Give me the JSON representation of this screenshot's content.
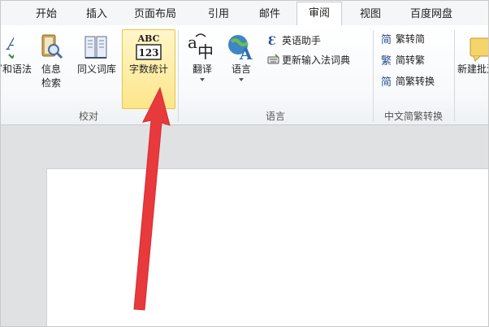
{
  "tabs": [
    {
      "label": "开始",
      "active": false
    },
    {
      "label": "插入",
      "active": false
    },
    {
      "label": "页面布局",
      "active": false
    },
    {
      "label": "引用",
      "active": false
    },
    {
      "label": "邮件",
      "active": false
    },
    {
      "label": "审阅",
      "active": true
    },
    {
      "label": "视图",
      "active": false
    },
    {
      "label": "百度网盘",
      "active": false
    }
  ],
  "ribbon": {
    "proofing": {
      "group_label": "校对",
      "grammar_label": "拼写和语法",
      "research_label_line1": "信息",
      "research_label_line2": "检索",
      "thesaurus_label": "同义词库",
      "word_count_label": "字数统计",
      "word_count_icon_text_top": "ABC",
      "word_count_icon_text_bottom": "123"
    },
    "language": {
      "group_label": "语言",
      "translate_label": "翻译",
      "language_label": "语言",
      "english_assistant_label": "英语助手",
      "update_ime_label": "更新输入法词典"
    },
    "chinese_conversion": {
      "group_label": "中文简繁转换",
      "trad_to_simp_label": "繁转简",
      "simp_to_trad_label": "简转繁",
      "convert_label": "简繁转换"
    },
    "comments": {
      "new_comment_label": "新建批注"
    }
  },
  "colors": {
    "arrow": "#e8393d",
    "highlight": "#fde68a",
    "active_tab_border": "#c6cbd1"
  }
}
